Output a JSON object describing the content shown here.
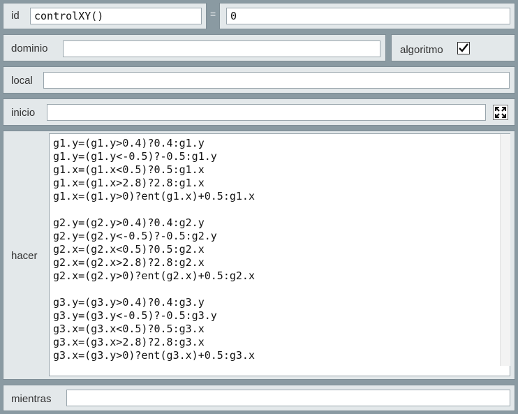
{
  "id": {
    "label": "id",
    "value": "controlXY()"
  },
  "equals": {
    "label": "=",
    "value": "0"
  },
  "dominio": {
    "label": "dominio",
    "value": ""
  },
  "algoritmo": {
    "label": "algoritmo",
    "checked": true
  },
  "local": {
    "label": "local",
    "value": ""
  },
  "inicio": {
    "label": "inicio",
    "value": "",
    "button_icon": "expand-icon"
  },
  "hacer": {
    "label": "hacer",
    "code": "g1.y=(g1.y>0.4)?0.4:g1.y\ng1.y=(g1.y<-0.5)?-0.5:g1.y\ng1.x=(g1.x<0.5)?0.5:g1.x\ng1.x=(g1.x>2.8)?2.8:g1.x\ng1.x=(g1.y>0)?ent(g1.x)+0.5:g1.x\n\ng2.y=(g2.y>0.4)?0.4:g2.y\ng2.y=(g2.y<-0.5)?-0.5:g2.y\ng2.x=(g2.x<0.5)?0.5:g2.x\ng2.x=(g2.x>2.8)?2.8:g2.x\ng2.x=(g2.y>0)?ent(g2.x)+0.5:g2.x\n\ng3.y=(g3.y>0.4)?0.4:g3.y\ng3.y=(g3.y<-0.5)?-0.5:g3.y\ng3.x=(g3.x<0.5)?0.5:g3.x\ng3.x=(g3.x>2.8)?2.8:g3.x\ng3.x=(g3.y>0)?ent(g3.x)+0.5:g3.x"
  },
  "mientras": {
    "label": "mientras",
    "value": ""
  }
}
